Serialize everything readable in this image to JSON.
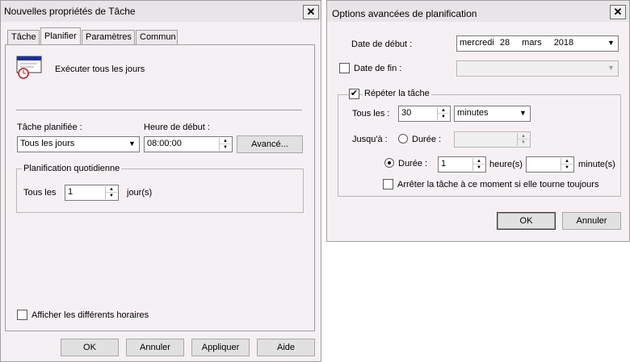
{
  "left_window": {
    "title": "Nouvelles propriétés de Tâche",
    "tabs": [
      "Tâche",
      "Planifier",
      "Paramètres",
      "Commun"
    ],
    "active_tab": "Planifier",
    "schedule_summary": "Exécuter tous les jours",
    "task_schedule_label": "Tâche planifiée :",
    "task_schedule_value": "Tous les jours",
    "start_time_label": "Heure de début :",
    "start_time_value": "08:00:00",
    "advanced_button": "Avancé...",
    "daily_group_title": "Planification quotidienne",
    "every_label": "Tous les",
    "every_value": "1",
    "days_unit": "jour(s)",
    "show_multiple_label": "Afficher les différents horaires",
    "buttons": {
      "ok": "OK",
      "cancel": "Annuler",
      "apply": "Appliquer",
      "help": "Aide"
    }
  },
  "right_window": {
    "title": "Options avancées de planification",
    "start_date_label": "Date de début :",
    "start_date": {
      "weekday": "mercredi",
      "day": "28",
      "month": "mars",
      "year": "2018"
    },
    "end_date_label": "Date de fin :",
    "end_date_checked": false,
    "repeat_label": "Répéter la tâche",
    "repeat_checked": true,
    "every_label": "Tous les :",
    "every_value": "30",
    "unit_value": "minutes",
    "until_label": "Jusqu'à :",
    "duration_label": "Durée :",
    "duration_selected": "second",
    "duration_hours": "1",
    "hours_unit": "heure(s)",
    "duration_minutes": "",
    "minutes_unit": "minute(s)",
    "stop_label": "Arrêter la tâche à ce moment si elle tourne toujours",
    "stop_checked": false,
    "buttons": {
      "ok": "OK",
      "cancel": "Annuler"
    }
  }
}
